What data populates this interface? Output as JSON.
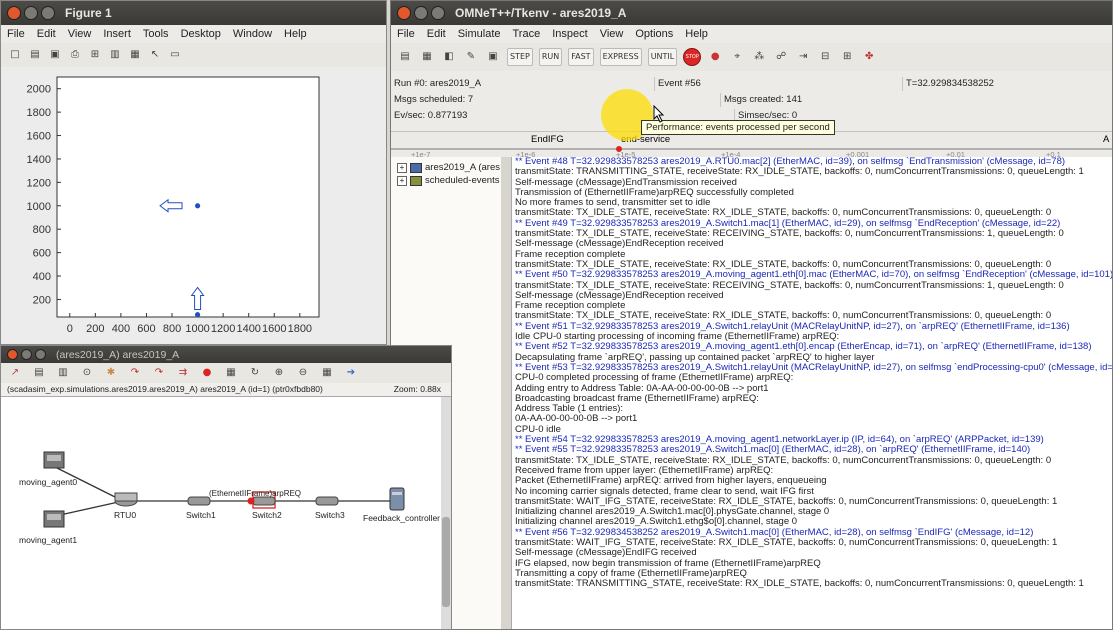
{
  "figure": {
    "title": "Figure 1",
    "menu": [
      "File",
      "Edit",
      "View",
      "Insert",
      "Tools",
      "Desktop",
      "Window",
      "Help"
    ],
    "chart_data": {
      "type": "scatter",
      "x_ticks": [
        "0",
        "200",
        "400",
        "600",
        "800",
        "1000",
        "1200",
        "1400",
        "1600",
        "1800"
      ],
      "y_ticks": [
        "200",
        "400",
        "600",
        "800",
        "1000",
        "1200",
        "1400",
        "1600",
        "1800",
        "2000"
      ],
      "xlim": [
        -100,
        1950
      ],
      "ylim": [
        50,
        2100
      ],
      "grid": false,
      "points": [
        {
          "x": 1000,
          "y": 1000
        },
        {
          "x": 1000,
          "y": 70
        }
      ],
      "arrows": [
        {
          "x": 800,
          "y": 1000,
          "dir": "left"
        },
        {
          "x": 1000,
          "y": 200,
          "dir": "up"
        }
      ]
    }
  },
  "omnet": {
    "title": "OMNeT++/Tkenv - ares2019_A",
    "menu": [
      "File",
      "Edit",
      "Simulate",
      "Trace",
      "Inspect",
      "View",
      "Options",
      "Help"
    ],
    "toolbar": [
      "STEP",
      "RUN",
      "FAST",
      "EXPRESS",
      "UNTIL",
      "STOP"
    ],
    "status": {
      "run": "Run #0: ares2019_A",
      "event": "Event #56",
      "time": "T=32.929834538252",
      "scheduled": "Msgs scheduled: 7",
      "created": "Msgs created: 141",
      "evsec": "Ev/sec: 0.877193",
      "simsec": "Simsec/sec: 0"
    },
    "tooltip": "Performance: events processed per second",
    "timeline": {
      "labels": [
        "EndIFG",
        "end-service"
      ],
      "ticks": [
        "+1e-7",
        "+1e-6",
        "+1e-5",
        "+1e-4",
        "+0.001",
        "+0.01",
        "+0.1"
      ],
      "edge_letter": "A"
    },
    "tree": [
      {
        "label": "ares2019_A (ares",
        "sign": "+"
      },
      {
        "label": "scheduled-events",
        "sign": "+"
      }
    ],
    "log": [
      {
        "t": "** Event #48  T=32.929833578253  ares2019_A.RTU0.mac[2] (EtherMAC, id=39), on selfmsg `EndTransmission' (cMessage, id=78)",
        "ev": true
      },
      {
        "t": "transmitState: TRANSMITTING_STATE, receiveState: RX_IDLE_STATE, backoffs: 0, numConcurrentTransmissions: 0, queueLength: 1"
      },
      {
        "t": "Self-message (cMessage)EndTransmission received"
      },
      {
        "t": "Transmission of (EthernetIIFrame)arpREQ successfully completed"
      },
      {
        "t": "No more frames to send, transmitter set to idle"
      },
      {
        "t": "transmitState: TX_IDLE_STATE, receiveState: RX_IDLE_STATE, backoffs: 0, numConcurrentTransmissions: 0, queueLength: 0"
      },
      {
        "t": "** Event #49  T=32.929833578253  ares2019_A.Switch1.mac[1] (EtherMAC, id=29), on selfmsg `EndReception' (cMessage, id=22)",
        "ev": true
      },
      {
        "t": "transmitState: TX_IDLE_STATE, receiveState: RECEIVING_STATE, backoffs: 0, numConcurrentTransmissions: 1, queueLength: 0"
      },
      {
        "t": "Self-message (cMessage)EndReception received"
      },
      {
        "t": "Frame reception complete"
      },
      {
        "t": "transmitState: TX_IDLE_STATE, receiveState: RX_IDLE_STATE, backoffs: 0, numConcurrentTransmissions: 0, queueLength: 0"
      },
      {
        "t": "** Event #50  T=32.929833578253  ares2019_A.moving_agent1.eth[0].mac (EtherMAC, id=70), on selfmsg `EndReception' (cMessage, id=101)",
        "ev": true
      },
      {
        "t": "transmitState: TX_IDLE_STATE, receiveState: RECEIVING_STATE, backoffs: 0, numConcurrentTransmissions: 1, queueLength: 0"
      },
      {
        "t": "Self-message (cMessage)EndReception received"
      },
      {
        "t": "Frame reception complete"
      },
      {
        "t": "transmitState: TX_IDLE_STATE, receiveState: RX_IDLE_STATE, backoffs: 0, numConcurrentTransmissions: 0, queueLength: 0"
      },
      {
        "t": "** Event #51  T=32.929833578253  ares2019_A.Switch1.relayUnit (MACRelayUnitNP, id=27), on `arpREQ' (EthernetIIFrame, id=136)",
        "ev": true
      },
      {
        "t": "Idle CPU-0 starting processing of incoming frame (EthernetIIFrame) arpREQ:"
      },
      {
        "t": "** Event #52  T=32.929833578253  ares2019_A.moving_agent1.eth[0].encap (EtherEncap, id=71), on `arpREQ' (EthernetIIFrame, id=138)",
        "ev": true
      },
      {
        "t": "Decapsulating frame `arpREQ', passing up contained packet `arpREQ' to higher layer"
      },
      {
        "t": "** Event #53  T=32.929833578253  ares2019_A.Switch1.relayUnit (MACRelayUnitNP, id=27), on selfmsg `endProcessing-cpu0' (cMessage, id=10)",
        "ev": true
      },
      {
        "t": "CPU-0 completed processing of frame (EthernetIIFrame) arpREQ:"
      },
      {
        "t": "Adding entry to Address Table: 0A-AA-00-00-00-0B --> port1"
      },
      {
        "t": "Broadcasting broadcast frame (EthernetIIFrame) arpREQ:"
      },
      {
        "t": "Address Table (1 entries):"
      },
      {
        "t": "  0A-AA-00-00-00-0B --> port1"
      },
      {
        "t": "CPU-0 idle"
      },
      {
        "t": "** Event #54  T=32.929833578253  ares2019_A.moving_agent1.networkLayer.ip (IP, id=64), on `arpREQ' (ARPPacket, id=139)",
        "ev": true
      },
      {
        "t": "** Event #55  T=32.929833578253  ares2019_A.Switch1.mac[0] (EtherMAC, id=28), on `arpREQ' (EthernetIIFrame, id=140)",
        "ev": true
      },
      {
        "t": "transmitState: TX_IDLE_STATE, receiveState: RX_IDLE_STATE, backoffs: 0, numConcurrentTransmissions: 0, queueLength: 0"
      },
      {
        "t": "Received frame from upper layer: (EthernetIIFrame) arpREQ:"
      },
      {
        "t": "Packet (EthernetIIFrame) arpREQ: arrived from higher layers, enqueueing"
      },
      {
        "t": "No incoming carrier signals detected, frame clear to send, wait IFG first"
      },
      {
        "t": "transmitState: WAIT_IFG_STATE, receiveState: RX_IDLE_STATE, backoffs: 0, numConcurrentTransmissions: 0, queueLength: 1"
      },
      {
        "t": "Initializing channel ares2019_A.Switch1.mac[0].physGate.channel, stage 0"
      },
      {
        "t": "Initializing channel ares2019_A.Switch1.ethg$o[0].channel, stage 0"
      },
      {
        "t": "** Event #56  T=32.929834538252  ares2019_A.Switch1.mac[0] (EtherMAC, id=28), on selfmsg `EndIFG' (cMessage, id=12)",
        "ev": true
      },
      {
        "t": "transmitState: WAIT_IFG_STATE, receiveState: RX_IDLE_STATE, backoffs: 0, numConcurrentTransmissions: 0, queueLength: 1"
      },
      {
        "t": "Self-message (cMessage)EndIFG received"
      },
      {
        "t": "IFG elapsed, now begin transmission of frame (EthernetIIFrame)arpREQ"
      },
      {
        "t": "Transmitting a copy of frame (EthernetIIFrame)arpREQ"
      },
      {
        "t": "transmitState: TRANSMITTING_STATE, receiveState: RX_IDLE_STATE, backoffs: 0, numConcurrentTransmissions: 0, queueLength: 1"
      }
    ]
  },
  "network": {
    "title": "(ares2019_A) ares2019_A",
    "path": "(scadasim_exp.simulations.ares2019.ares2019_A) ares2019_A (id=1)  (ptr0xfbdb80)",
    "zoom": "Zoom: 0.88x",
    "nodes": {
      "agent0": "moving_agent0",
      "agent1": "moving_agent1",
      "rtu": "RTU0",
      "sw1": "Switch1",
      "sw2": "Switch2",
      "sw3": "Switch3",
      "fc": "Feedback_controller"
    },
    "message_label": "(EthernetIIFrame)arpREQ"
  }
}
